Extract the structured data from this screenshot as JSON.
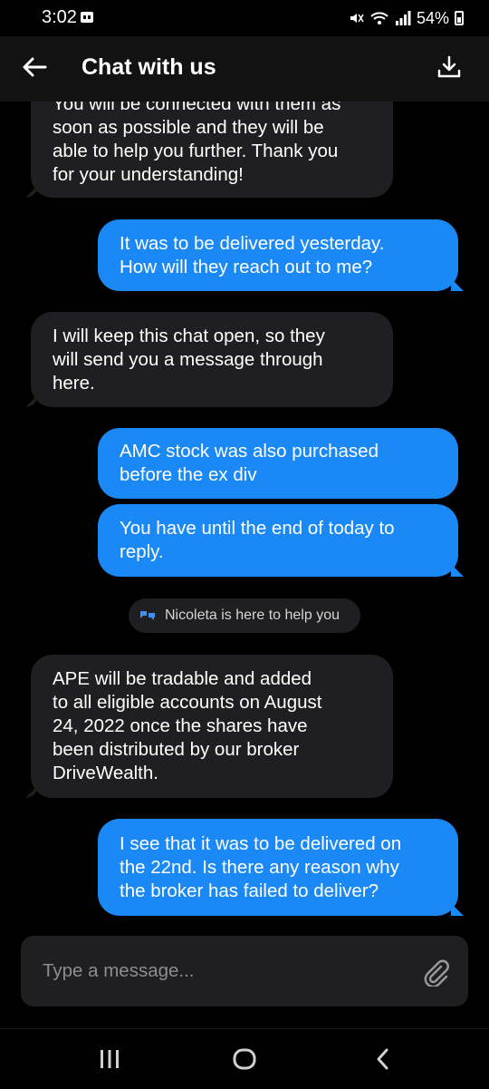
{
  "status_bar": {
    "time": "3:02",
    "battery": "54%"
  },
  "header": {
    "title": "Chat with us"
  },
  "messages": [
    {
      "from": "agent",
      "text": "You will be connected with them as\nsoon as possible and they will be\nable to help you further. Thank you\nfor your understanding!"
    },
    {
      "from": "user",
      "text": "It was to be delivered yesterday.\nHow will they reach out to me?"
    },
    {
      "from": "agent",
      "text": "I will keep this chat open, so they\nwill send you a message through\nhere."
    },
    {
      "from": "user",
      "text": "AMC stock was also purchased\nbefore the ex div"
    },
    {
      "from": "user",
      "text": "You have until the end of today to\nreply."
    },
    {
      "from": "agent",
      "text": "APE will be tradable and added\nto all eligible accounts on August\n24, 2022 once the shares have\nbeen distributed by our broker\nDriveWealth."
    },
    {
      "from": "user",
      "text": "I see that it was to be delivered on\nthe 22nd. Is there any reason why\nthe broker has failed to deliver?"
    }
  ],
  "agent_joined": "Nicoleta is here to help you",
  "composer": {
    "placeholder": "Type a message..."
  },
  "colors": {
    "user_bubble": "#1a88f5",
    "agent_bubble": "#1f1f21",
    "background": "#000000"
  },
  "icons": [
    "back-arrow-icon",
    "download-icon",
    "chat-bubbles-icon",
    "paperclip-icon",
    "recents-icon",
    "home-icon",
    "nav-back-icon"
  ]
}
